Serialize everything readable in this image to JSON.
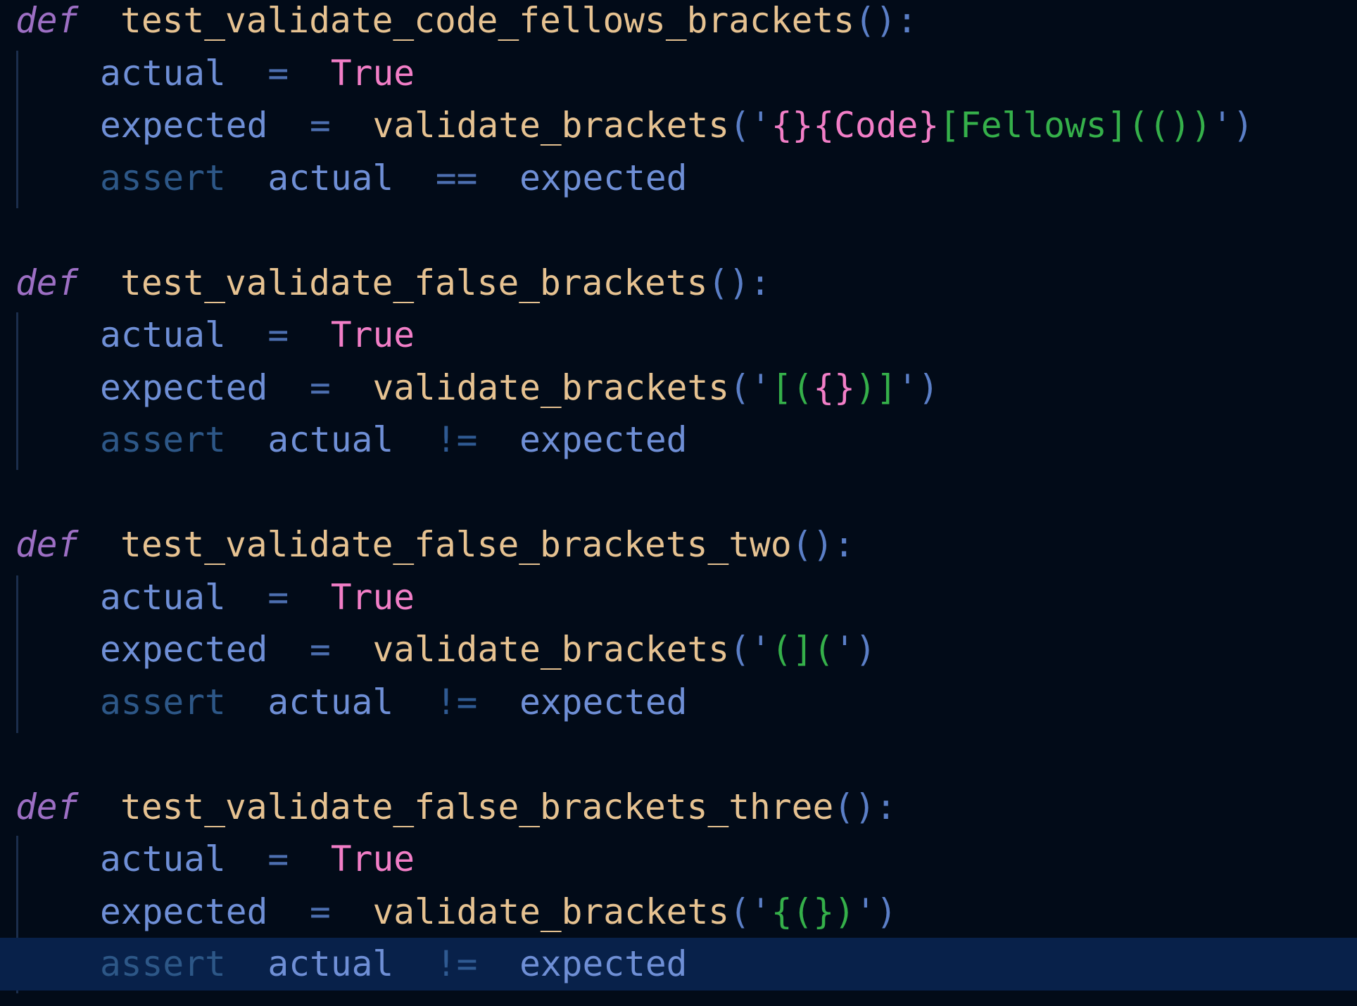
{
  "editor": {
    "theme_colors": {
      "background": "#020b18",
      "current_line": "#08214a",
      "keyword_def": "#9d6fc4",
      "function_name": "#e6c291",
      "boolean": "#f27ec7",
      "string_green": "#35b04a",
      "string_pink": "#f27ec7",
      "variable": "#6f8fd6",
      "assert": "#2d5787"
    },
    "lines": [
      {
        "tokens": [
          [
            "kw-def",
            "def"
          ],
          [
            "",
            "  "
          ],
          [
            "fn-name",
            "test_validate_code_fellows_brackets"
          ],
          [
            "punct",
            "():"
          ]
        ]
      },
      {
        "tokens": [
          [
            "var",
            "actual"
          ],
          [
            "",
            "  "
          ],
          [
            "op",
            "="
          ],
          [
            "",
            "  "
          ],
          [
            "const",
            "True"
          ]
        ]
      },
      {
        "tokens": [
          [
            "var",
            "expected"
          ],
          [
            "",
            "  "
          ],
          [
            "op",
            "="
          ],
          [
            "",
            "  "
          ],
          [
            "call",
            "validate_brackets"
          ],
          [
            "punct",
            "("
          ],
          [
            "str-q",
            "'"
          ],
          [
            "str-p",
            "{}{Code}"
          ],
          [
            "str-g",
            "[Fellows](())"
          ],
          [
            "str-q",
            "'"
          ],
          [
            "punct",
            ")"
          ]
        ]
      },
      {
        "tokens": [
          [
            "kw-assert",
            "assert"
          ],
          [
            "",
            "  "
          ],
          [
            "var",
            "actual"
          ],
          [
            "",
            "  "
          ],
          [
            "op",
            "=="
          ],
          [
            "",
            "  "
          ],
          [
            "var",
            "expected"
          ]
        ]
      },
      {
        "tokens": []
      },
      {
        "tokens": [
          [
            "kw-def",
            "def"
          ],
          [
            "",
            "  "
          ],
          [
            "fn-name",
            "test_validate_false_brackets"
          ],
          [
            "punct",
            "():"
          ]
        ]
      },
      {
        "tokens": [
          [
            "var",
            "actual"
          ],
          [
            "",
            "  "
          ],
          [
            "op",
            "="
          ],
          [
            "",
            "  "
          ],
          [
            "const",
            "True"
          ]
        ]
      },
      {
        "tokens": [
          [
            "var",
            "expected"
          ],
          [
            "",
            "  "
          ],
          [
            "op",
            "="
          ],
          [
            "",
            "  "
          ],
          [
            "call",
            "validate_brackets"
          ],
          [
            "punct",
            "("
          ],
          [
            "str-q",
            "'"
          ],
          [
            "str-g",
            "[("
          ],
          [
            "str-p",
            "{}"
          ],
          [
            "str-g",
            ")]"
          ],
          [
            "str-q",
            "'"
          ],
          [
            "punct",
            ")"
          ]
        ]
      },
      {
        "tokens": [
          [
            "kw-assert",
            "assert"
          ],
          [
            "",
            "  "
          ],
          [
            "var",
            "actual"
          ],
          [
            "",
            "  "
          ],
          [
            "op-neq",
            "!="
          ],
          [
            "",
            "  "
          ],
          [
            "var",
            "expected"
          ]
        ]
      },
      {
        "tokens": []
      },
      {
        "tokens": [
          [
            "kw-def",
            "def"
          ],
          [
            "",
            "  "
          ],
          [
            "fn-name",
            "test_validate_false_brackets_two"
          ],
          [
            "punct",
            "():"
          ]
        ]
      },
      {
        "tokens": [
          [
            "var",
            "actual"
          ],
          [
            "",
            "  "
          ],
          [
            "op",
            "="
          ],
          [
            "",
            "  "
          ],
          [
            "const",
            "True"
          ]
        ]
      },
      {
        "tokens": [
          [
            "var",
            "expected"
          ],
          [
            "",
            "  "
          ],
          [
            "op",
            "="
          ],
          [
            "",
            "  "
          ],
          [
            "call",
            "validate_brackets"
          ],
          [
            "punct",
            "("
          ],
          [
            "str-q",
            "'"
          ],
          [
            "str-g",
            "(]("
          ],
          [
            "str-q",
            "'"
          ],
          [
            "punct",
            ")"
          ]
        ]
      },
      {
        "tokens": [
          [
            "kw-assert",
            "assert"
          ],
          [
            "",
            "  "
          ],
          [
            "var",
            "actual"
          ],
          [
            "",
            "  "
          ],
          [
            "op-neq",
            "!="
          ],
          [
            "",
            "  "
          ],
          [
            "var",
            "expected"
          ]
        ]
      },
      {
        "tokens": []
      },
      {
        "tokens": [
          [
            "kw-def",
            "def"
          ],
          [
            "",
            "  "
          ],
          [
            "fn-name",
            "test_validate_false_brackets_three"
          ],
          [
            "punct",
            "():"
          ]
        ]
      },
      {
        "tokens": [
          [
            "var",
            "actual"
          ],
          [
            "",
            "  "
          ],
          [
            "op",
            "="
          ],
          [
            "",
            "  "
          ],
          [
            "const",
            "True"
          ]
        ]
      },
      {
        "tokens": [
          [
            "var",
            "expected"
          ],
          [
            "",
            "  "
          ],
          [
            "op",
            "="
          ],
          [
            "",
            "  "
          ],
          [
            "call",
            "validate_brackets"
          ],
          [
            "punct",
            "("
          ],
          [
            "str-q",
            "'"
          ],
          [
            "str-g",
            "{(})"
          ],
          [
            "str-q",
            "'"
          ],
          [
            "punct",
            ")"
          ]
        ]
      },
      {
        "tokens": [
          [
            "kw-assert",
            "assert"
          ],
          [
            "",
            "  "
          ],
          [
            "var",
            "actual"
          ],
          [
            "",
            "  "
          ],
          [
            "op-neq",
            "!="
          ],
          [
            "",
            "  "
          ],
          [
            "var",
            "expected"
          ]
        ]
      }
    ]
  }
}
